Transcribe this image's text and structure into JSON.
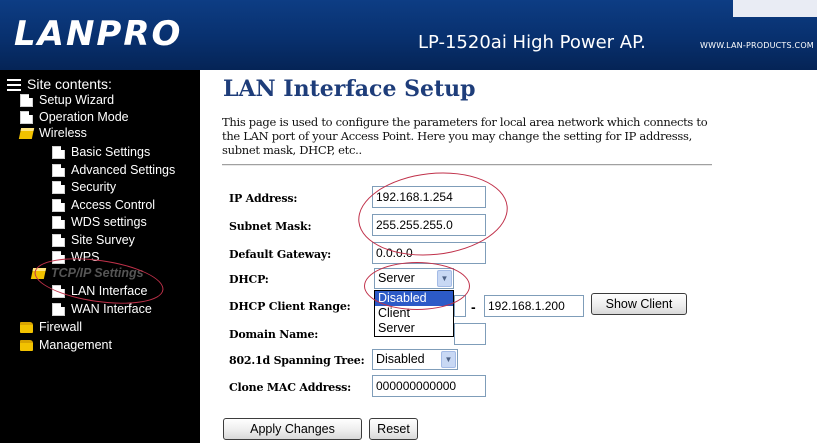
{
  "header": {
    "logo": "LANPRO",
    "model": "LP-1520ai  High Power AP.",
    "url": "WWW.LAN-PRODUCTS.COM"
  },
  "sidebar": {
    "title": "Site contents:",
    "items": [
      {
        "label": "Setup Wizard",
        "icon": "page-icon"
      },
      {
        "label": "Operation Mode",
        "icon": "page-icon"
      },
      {
        "label": "Wireless",
        "icon": "open-folder-icon"
      },
      {
        "label": "Basic Settings",
        "icon": "page-icon"
      },
      {
        "label": "Advanced Settings",
        "icon": "page-icon"
      },
      {
        "label": "Security",
        "icon": "page-icon"
      },
      {
        "label": "Access Control",
        "icon": "page-icon"
      },
      {
        "label": "WDS settings",
        "icon": "page-icon"
      },
      {
        "label": "Site Survey",
        "icon": "page-icon"
      },
      {
        "label": "WPS",
        "icon": "page-icon"
      },
      {
        "label": "TCP/IP Settings",
        "icon": "open-folder-icon"
      },
      {
        "label": "LAN Interface",
        "icon": "page-icon"
      },
      {
        "label": "WAN Interface",
        "icon": "page-icon"
      },
      {
        "label": "Firewall",
        "icon": "folder-icon"
      },
      {
        "label": "Management",
        "icon": "folder-icon"
      }
    ]
  },
  "main": {
    "title": "LAN Interface Setup",
    "description": "This page is used to configure the parameters for local area network which connects to the LAN port of your Access Point. Here you may change the setting for IP addresss, subnet mask, DHCP, etc..",
    "form": {
      "ip_label": "IP Address:",
      "ip_value": "192.168.1.254",
      "subnet_label": "Subnet Mask:",
      "subnet_value": "255.255.255.0",
      "gateway_label": "Default Gateway:",
      "gateway_value": "0.0.0.0",
      "dhcp_label": "DHCP:",
      "dhcp_value": "Server",
      "dhcp_options": [
        "Disabled",
        "Client",
        "Server"
      ],
      "range_label": "DHCP Client Range:",
      "range_start": "",
      "range_dash": "-",
      "range_end": "192.168.1.200",
      "show_client": "Show Client",
      "domain_label": "Domain Name:",
      "domain_value": "",
      "stp_label": "802.1d Spanning Tree:",
      "stp_value": "Disabled",
      "mac_label": "Clone MAC Address:",
      "mac_value": "000000000000"
    },
    "buttons": {
      "apply": "Apply Changes",
      "reset": "Reset"
    }
  },
  "colors": {
    "header_blue": "#08306e",
    "title_blue": "#1e3d7a",
    "annotation_red": "#c0314a",
    "selection_blue": "#2c5ac7"
  }
}
